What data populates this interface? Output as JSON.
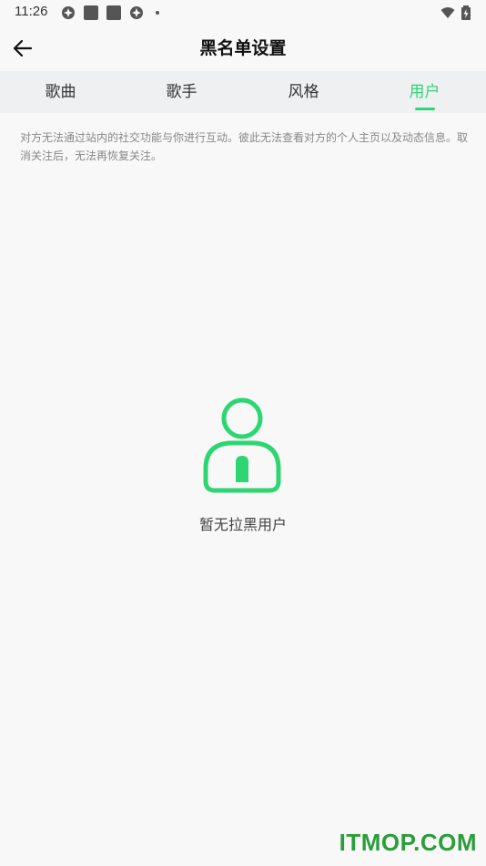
{
  "status_bar": {
    "time": "11:26",
    "icons": [
      "notification-icon",
      "app-icon",
      "app-icon",
      "notification-icon",
      "dot-icon",
      "wifi-icon",
      "battery-icon"
    ]
  },
  "header": {
    "title": "黑名单设置",
    "back_icon": "back-arrow-icon"
  },
  "tabs": [
    {
      "label": "歌曲",
      "active": false
    },
    {
      "label": "歌手",
      "active": false
    },
    {
      "label": "风格",
      "active": false
    },
    {
      "label": "用户",
      "active": true
    }
  ],
  "notice": {
    "text": "对方无法通过站内的社交功能与你进行互动。彼此无法查看对方的个人主页以及动态信息。取消关注后，无法再恢复关注。"
  },
  "empty_state": {
    "icon": "user-icon",
    "text": "暂无拉黑用户"
  },
  "watermark": {
    "text": "ITMOP.COM"
  },
  "colors": {
    "accent": "#2ed573",
    "background": "#f8f8f8",
    "tab_background": "#eef0f2",
    "watermark": "#2b9d3b"
  }
}
